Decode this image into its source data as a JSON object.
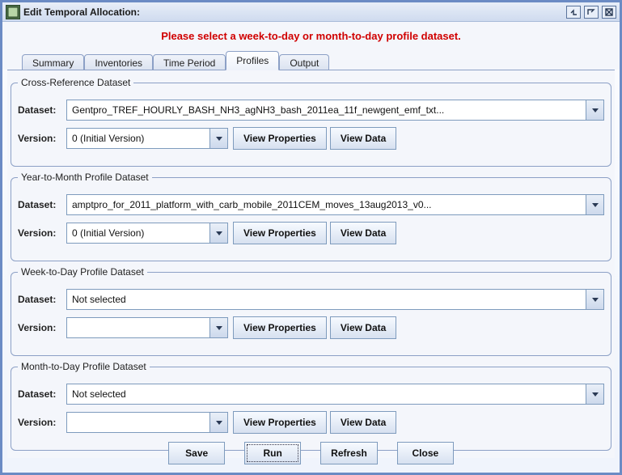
{
  "window": {
    "title": "Edit Temporal Allocation:"
  },
  "warning": "Please select a week-to-day or month-to-day profile dataset.",
  "tabs": [
    {
      "label": "Summary"
    },
    {
      "label": "Inventories"
    },
    {
      "label": "Time Period"
    },
    {
      "label": "Profiles"
    },
    {
      "label": "Output"
    }
  ],
  "panels": {
    "cross_ref": {
      "legend": "Cross-Reference Dataset",
      "dataset_label": "Dataset:",
      "dataset_value": "Gentpro_TREF_HOURLY_BASH_NH3_agNH3_bash_2011ea_11f_newgent_emf_txt...",
      "version_label": "Version:",
      "version_value": "0 (Initial Version)",
      "view_props": "View Properties",
      "view_data": "View Data"
    },
    "year_month": {
      "legend": "Year-to-Month Profile Dataset",
      "dataset_label": "Dataset:",
      "dataset_value": "amptpro_for_2011_platform_with_carb_mobile_2011CEM_moves_13aug2013_v0...",
      "version_label": "Version:",
      "version_value": "0 (Initial Version)",
      "view_props": "View Properties",
      "view_data": "View Data"
    },
    "week_day": {
      "legend": "Week-to-Day Profile Dataset",
      "dataset_label": "Dataset:",
      "dataset_value": "Not selected",
      "version_label": "Version:",
      "version_value": "",
      "view_props": "View Properties",
      "view_data": "View Data"
    },
    "month_day": {
      "legend": "Month-to-Day Profile Dataset",
      "dataset_label": "Dataset:",
      "dataset_value": "Not selected",
      "version_label": "Version:",
      "version_value": "",
      "view_props": "View Properties",
      "view_data": "View Data"
    }
  },
  "actions": {
    "save": "Save",
    "run": "Run",
    "refresh": "Refresh",
    "close": "Close"
  }
}
